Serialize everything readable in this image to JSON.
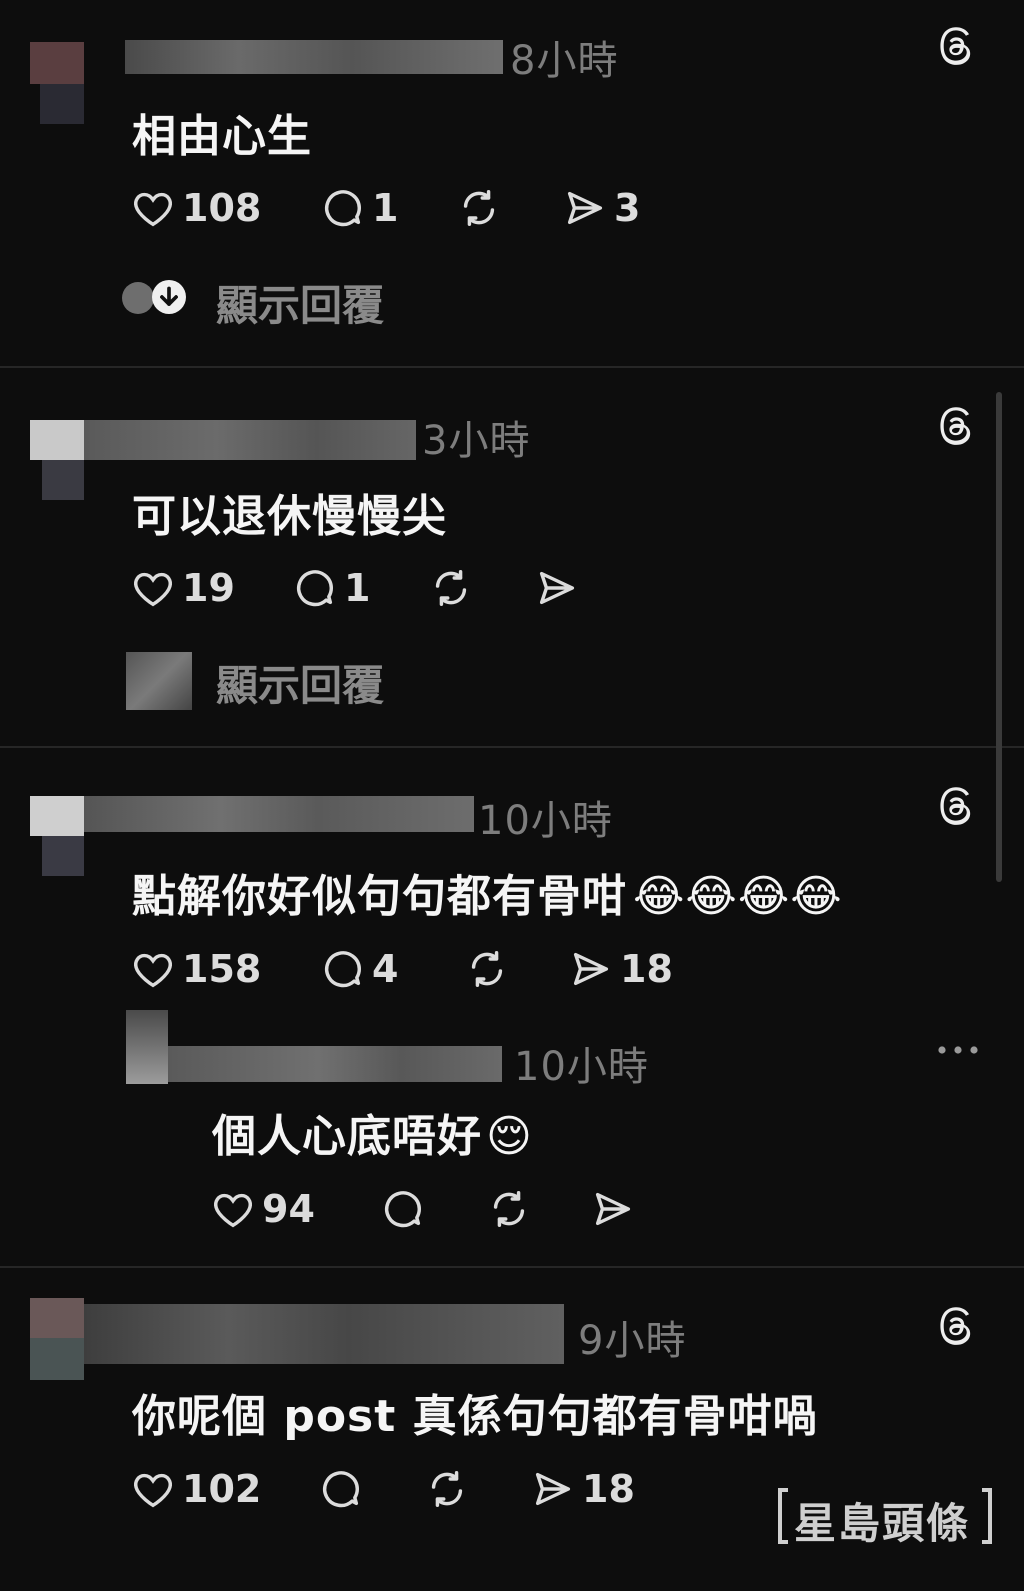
{
  "comments": [
    {
      "time": "8小時",
      "text": "相由心生",
      "likes": "108",
      "replies": "1",
      "reposts": "",
      "shares": "3",
      "show_replies": "顯示回覆"
    },
    {
      "time": "3小時",
      "text": "可以退休慢慢尖",
      "likes": "19",
      "replies": "1",
      "reposts": "",
      "shares": "",
      "show_replies": "顯示回覆"
    },
    {
      "time": "10小時",
      "text": "點解你好似句句都有骨咁",
      "emoji": "😂😂😂😂",
      "likes": "158",
      "replies": "4",
      "reposts": "",
      "shares": "18"
    },
    {
      "time": "10小時",
      "text": "個人心底唔好",
      "emoji": "😌",
      "likes": "94",
      "replies": "",
      "reposts": "",
      "shares": ""
    },
    {
      "time": "9小時",
      "text": "你呢個 post 真係句句都有骨咁喎",
      "likes": "102",
      "replies": "",
      "reposts": "",
      "shares": "18"
    }
  ],
  "watermark": "星島頭條",
  "icons": {
    "like": "heart-icon",
    "reply": "comment-bubble-icon",
    "repost": "repost-icon",
    "share": "send-icon",
    "threads": "threads-logo-icon",
    "more": "more-dots-icon"
  },
  "colors": {
    "background": "#0d0d0d",
    "text": "#f5f5f5",
    "muted": "#7d7d7d"
  }
}
